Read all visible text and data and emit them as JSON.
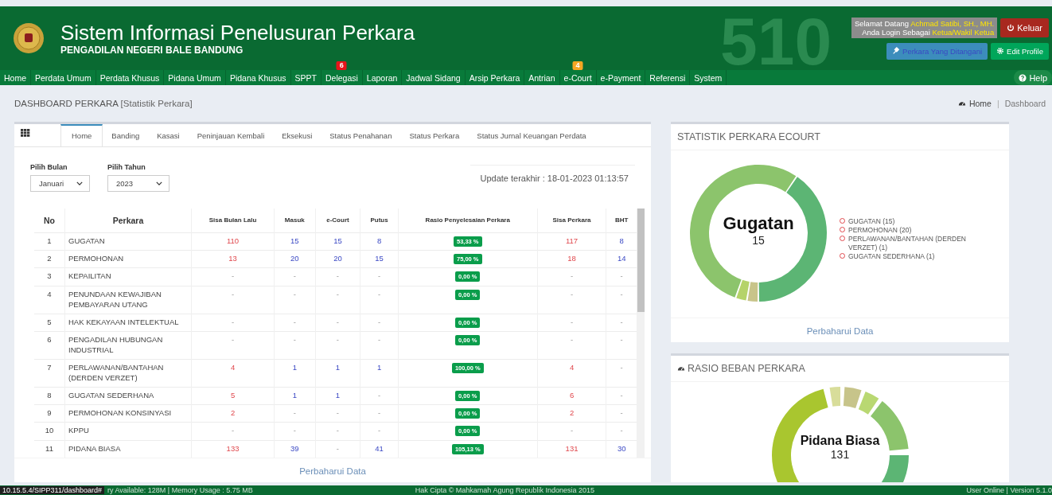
{
  "header": {
    "title": "Sistem Informasi Penelusuran Perkara",
    "subtitle": "PENGADILAN NEGERI BALE BANDUNG",
    "backdrop_text": "510",
    "user": {
      "greeting": "Selamat Datang",
      "name": "Achmad Satibi, SH., MH.",
      "login_text": "Anda Login Sebagai",
      "role": "Ketua/Wakil Ketua"
    },
    "logout_button": "Keluar",
    "cases_button": "Perkara Yang Ditangani",
    "profile_button": "Edit Profile"
  },
  "nav": {
    "items": [
      {
        "label": "Home"
      },
      {
        "label": "Perdata Umum"
      },
      {
        "label": "Perdata Khusus"
      },
      {
        "label": "Pidana Umum"
      },
      {
        "label": "Pidana Khusus"
      },
      {
        "label": "SPPT"
      },
      {
        "label": "Delegasi",
        "badge": {
          "text": "6",
          "color": "#e8141b"
        }
      },
      {
        "label": "Laporan"
      },
      {
        "label": "Jadwal Sidang"
      },
      {
        "label": "Arsip Perkara"
      },
      {
        "label": "Antrian"
      },
      {
        "label": "e-Court",
        "badge": {
          "text": "4",
          "color": "#f5a623"
        }
      },
      {
        "label": "e-Payment"
      },
      {
        "label": "Referensi"
      },
      {
        "label": "System"
      }
    ],
    "help": "Help"
  },
  "page_title": "DASHBOARD PERKARA",
  "page_subtitle": "[Statistik Perkara]",
  "breadcrumb": [
    "Home",
    "Dashboard"
  ],
  "breadcrumb_separator": "|",
  "tabs": [
    {
      "label": "Home",
      "selected": true
    },
    {
      "label": "Banding",
      "selected": false
    },
    {
      "label": "Kasasi",
      "selected": false
    },
    {
      "label": "Peninjauan Kembali",
      "selected": false
    },
    {
      "label": "Eksekusi",
      "selected": false
    },
    {
      "label": "Status Penahanan",
      "selected": false
    },
    {
      "label": "Status Perkara",
      "selected": false
    },
    {
      "label": "Status Jurnal Keuangan Perdata",
      "selected": false
    }
  ],
  "filters": [
    {
      "label": "Pilih Bulan",
      "value": "Januari"
    },
    {
      "label": "Pilih Tahun",
      "value": "2023"
    }
  ],
  "update_text": "Update terakhir : 18-01-2023 01:13:57",
  "table": {
    "columns": [
      "No",
      "Perkara",
      "Sisa Bulan Lalu",
      "Masuk",
      "e-Court",
      "Putus",
      "Rasio Penyelesaian Perkara",
      "Sisa Perkara",
      "BHT"
    ],
    "rows": [
      [
        "1",
        "GUGATAN",
        "110",
        "15",
        "15",
        "8",
        "53,33 %",
        "117",
        "8"
      ],
      [
        "2",
        "PERMOHONAN",
        "13",
        "20",
        "20",
        "15",
        "75,00 %",
        "18",
        "14"
      ],
      [
        "3",
        "KEPAILITAN",
        "-",
        "-",
        "-",
        "-",
        "0,00 %",
        "-",
        "-"
      ],
      [
        "4",
        "PENUNDAAN KEWAJIBAN PEMBAYARAN UTANG",
        "-",
        "-",
        "-",
        "-",
        "0,00 %",
        "-",
        "-"
      ],
      [
        "5",
        "HAK KEKAYAAN INTELEKTUAL",
        "-",
        "-",
        "-",
        "-",
        "0,00 %",
        "-",
        "-"
      ],
      [
        "6",
        "PENGADILAN HUBUNGAN INDUSTRIAL",
        "-",
        "-",
        "-",
        "-",
        "0,00 %",
        "-",
        "-"
      ],
      [
        "7",
        "PERLAWANAN/BANTAHAN (DERDEN VERZET)",
        "4",
        "1",
        "1",
        "1",
        "100,00 %",
        "4",
        "-"
      ],
      [
        "8",
        "GUGATAN SEDERHANA",
        "5",
        "1",
        "1",
        "-",
        "0,00 %",
        "6",
        "-"
      ],
      [
        "9",
        "PERMOHONAN KONSINYASI",
        "2",
        "-",
        "-",
        "-",
        "0,00 %",
        "2",
        "-"
      ],
      [
        "10",
        "KPPU",
        "-",
        "-",
        "-",
        "-",
        "0,00 %",
        "-",
        "-"
      ],
      [
        "11",
        "PIDANA BIASA",
        "133",
        "39",
        "-",
        "41",
        "105,13 %",
        "131",
        "30"
      ]
    ]
  },
  "refresh_link": "Perbaharui Data",
  "ecourt_panel": {
    "title": "STATISTIK PERKARA ECOURT",
    "center_label": "Gugatan",
    "center_value": "15",
    "chart_data": {
      "type": "donut",
      "categories": [
        "GUGATAN (15)",
        "PERMOHONAN (20)",
        "PERLAWANAN/BANTAHAN (DERDEN VERZET) (1)",
        "GUGATAN SEDERHANA (1)"
      ],
      "values": [
        15,
        20,
        1,
        1
      ]
    },
    "refresh_link": "Perbaharui Data"
  },
  "ratio_panel": {
    "title": "RASIO BEBAN PERKARA",
    "center_label": "Pidana Biasa",
    "center_value": "131"
  },
  "status_bar": {
    "url": "10.15.5.4/SIPP311/dashboard#",
    "memory": "ry Available: 128M | Memory Usage : 5.75 MB",
    "copyright": "Hak Cipta © Mahkamah Agung Republik Indonesia 2015",
    "right": "User Online | Version 5.1.0"
  }
}
